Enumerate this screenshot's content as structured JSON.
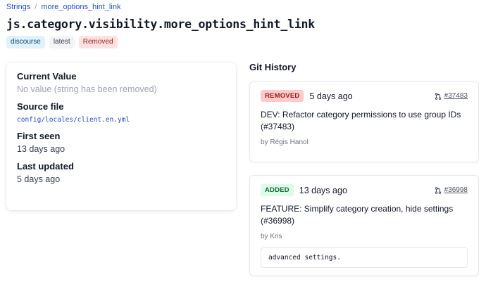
{
  "breadcrumb": {
    "root": "Strings",
    "separator": "/",
    "current": "more_options_hint_link"
  },
  "page": {
    "title": "js.category.visibility.more_options_hint_link"
  },
  "tags": [
    "discourse",
    "latest",
    "Removed"
  ],
  "details": {
    "current_value_label": "Current Value",
    "current_value": "No value (string has been removed)",
    "source_file_label": "Source file",
    "source_file": "config/locales/client.en.yml",
    "first_seen_label": "First seen",
    "first_seen": "13 days ago",
    "last_updated_label": "Last updated",
    "last_updated": "5 days ago"
  },
  "git_history": {
    "title": "Git History",
    "commits": [
      {
        "badge": "REMOVED",
        "age": "5 days ago",
        "pr": "#37483",
        "message": "DEV: Refactor category permissions to use group IDs (#37483)",
        "author": "by Régis Hanol"
      },
      {
        "badge": "ADDED",
        "age": "13 days ago",
        "pr": "#36998",
        "message": "FEATURE: Simplify category creation, hide settings (#36998)",
        "author": "by Kris",
        "snippet": "advanced settings."
      }
    ]
  },
  "colors": {
    "link": "#1d4ed8",
    "removed": "#991b1b",
    "added": "#166534"
  }
}
